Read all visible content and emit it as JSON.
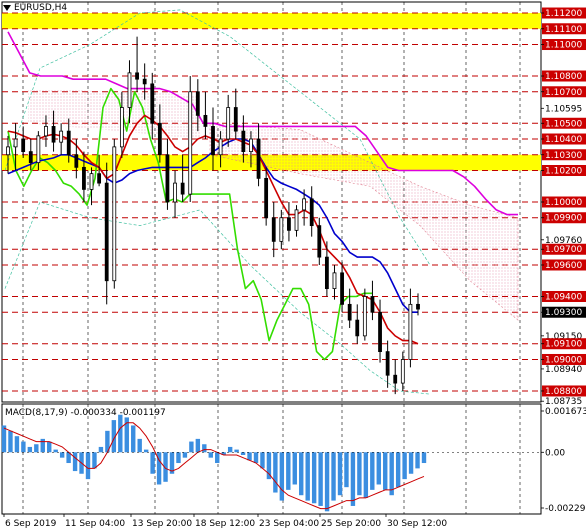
{
  "symbol": "EURUSD,H4",
  "macd_label": "MACD(8,17,9)",
  "macd_values": "-0.000334 -0.001197",
  "colors": {
    "red_level": "#c00000",
    "resist_zone": "#ffff00",
    "price_tag_red": "#cc0000",
    "price_tag_black": "#000000",
    "blue_ma": "#0000cc",
    "red_ma": "#cc0000",
    "green_line": "#33dd00",
    "magenta_line": "#dd00dd",
    "candles": "#000000",
    "macd_hist": "#3b8ee0",
    "macd_signal": "#cc0000"
  },
  "chart_data": {
    "type": "candlestick",
    "symbol": "EURUSD",
    "timeframe": "H4",
    "ylim": [
      1.0873,
      1.1127
    ],
    "y_ticks": [
      1.111,
      1.10595,
      1.10385,
      1.10175,
      1.09965,
      1.0976,
      1.0955,
      1.0934,
      1.0915,
      1.0894,
      1.08735
    ],
    "red_levels": [
      1.112,
      1.111,
      1.11,
      1.108,
      1.107,
      1.105,
      1.104,
      1.103,
      1.102,
      1.1,
      1.099,
      1.097,
      1.096,
      1.094,
      1.093,
      1.091,
      1.09,
      1.088
    ],
    "price_labels": [
      {
        "text": "1.11200",
        "style": "red"
      },
      {
        "text": "1.11100",
        "style": "red"
      },
      {
        "text": "1.11000",
        "style": "red"
      },
      {
        "text": "1.10800",
        "style": "red"
      },
      {
        "text": "1.10700",
        "style": "red"
      },
      {
        "text": "1.10595",
        "style": "plain"
      },
      {
        "text": "1.10500",
        "style": "red"
      },
      {
        "text": "1.10400",
        "style": "red"
      },
      {
        "text": "1.10300",
        "style": "red"
      },
      {
        "text": "1.10200",
        "style": "red"
      },
      {
        "text": "1.10000",
        "style": "red"
      },
      {
        "text": "1.09900",
        "style": "red"
      },
      {
        "text": "1.09760",
        "style": "plain"
      },
      {
        "text": "1.09700",
        "style": "red"
      },
      {
        "text": "1.09600",
        "style": "red"
      },
      {
        "text": "1.09400",
        "style": "red"
      },
      {
        "text": "1.09300",
        "style": "black"
      },
      {
        "text": "1.09150",
        "style": "plain"
      },
      {
        "text": "1.09100",
        "style": "red"
      },
      {
        "text": "1.09000",
        "style": "red"
      },
      {
        "text": "1.08940",
        "style": "plain"
      },
      {
        "text": "1.08800",
        "style": "red"
      },
      {
        "text": "1.08735",
        "style": "plain"
      }
    ],
    "price_label_values": [
      1.112,
      1.111,
      1.11,
      1.108,
      1.107,
      1.10595,
      1.105,
      1.104,
      1.103,
      1.102,
      1.1,
      1.099,
      1.0976,
      1.097,
      1.096,
      1.094,
      1.093,
      1.0915,
      1.091,
      1.09,
      1.0894,
      1.088,
      1.08735
    ],
    "zones": [
      [
        1.111,
        1.112
      ],
      [
        1.102,
        1.103
      ]
    ],
    "x_labels": [
      "6 Sep 2019",
      "11 Sep 04:00",
      "13 Sep 20:00",
      "18 Sep 12:00",
      "23 Sep 04:00",
      "25 Sep 20:00",
      "30 Sep 12:00"
    ],
    "candles": [
      {
        "o": 1.103,
        "h": 1.1042,
        "l": 1.1018,
        "c": 1.1035
      },
      {
        "o": 1.1035,
        "h": 1.105,
        "l": 1.102,
        "c": 1.104
      },
      {
        "o": 1.104,
        "h": 1.1048,
        "l": 1.1028,
        "c": 1.1032
      },
      {
        "o": 1.1032,
        "h": 1.104,
        "l": 1.102,
        "c": 1.1025
      },
      {
        "o": 1.1025,
        "h": 1.1045,
        "l": 1.102,
        "c": 1.1042
      },
      {
        "o": 1.1042,
        "h": 1.1055,
        "l": 1.1035,
        "c": 1.1048
      },
      {
        "o": 1.1048,
        "h": 1.1058,
        "l": 1.1032,
        "c": 1.1038
      },
      {
        "o": 1.1038,
        "h": 1.105,
        "l": 1.103,
        "c": 1.1045
      },
      {
        "o": 1.1045,
        "h": 1.1053,
        "l": 1.1025,
        "c": 1.103
      },
      {
        "o": 1.103,
        "h": 1.104,
        "l": 1.1015,
        "c": 1.1022
      },
      {
        "o": 1.1022,
        "h": 1.1032,
        "l": 1.1,
        "c": 1.1008
      },
      {
        "o": 1.1008,
        "h": 1.1022,
        "l": 1.0998,
        "c": 1.1018
      },
      {
        "o": 1.1018,
        "h": 1.103,
        "l": 1.101,
        "c": 1.1012
      },
      {
        "o": 1.1012,
        "h": 1.1025,
        "l": 1.0935,
        "c": 1.095
      },
      {
        "o": 1.095,
        "h": 1.104,
        "l": 1.0945,
        "c": 1.1035
      },
      {
        "o": 1.1035,
        "h": 1.107,
        "l": 1.1028,
        "c": 1.106
      },
      {
        "o": 1.106,
        "h": 1.109,
        "l": 1.105,
        "c": 1.1082
      },
      {
        "o": 1.1082,
        "h": 1.1105,
        "l": 1.107,
        "c": 1.1078
      },
      {
        "o": 1.1078,
        "h": 1.1088,
        "l": 1.1065,
        "c": 1.1075
      },
      {
        "o": 1.1075,
        "h": 1.1082,
        "l": 1.104,
        "c": 1.105
      },
      {
        "o": 1.105,
        "h": 1.1062,
        "l": 1.1025,
        "c": 1.103
      },
      {
        "o": 1.103,
        "h": 1.104,
        "l": 1.0995,
        "c": 1.1
      },
      {
        "o": 1.1,
        "h": 1.102,
        "l": 1.099,
        "c": 1.1012
      },
      {
        "o": 1.1012,
        "h": 1.103,
        "l": 1.1,
        "c": 1.1005
      },
      {
        "o": 1.1005,
        "h": 1.108,
        "l": 1.1,
        "c": 1.107
      },
      {
        "o": 1.107,
        "h": 1.1078,
        "l": 1.1045,
        "c": 1.1055
      },
      {
        "o": 1.1055,
        "h": 1.107,
        "l": 1.104,
        "c": 1.1048
      },
      {
        "o": 1.1048,
        "h": 1.106,
        "l": 1.102,
        "c": 1.103
      },
      {
        "o": 1.103,
        "h": 1.1045,
        "l": 1.1022,
        "c": 1.104
      },
      {
        "o": 1.104,
        "h": 1.1068,
        "l": 1.1035,
        "c": 1.106
      },
      {
        "o": 1.106,
        "h": 1.1072,
        "l": 1.104,
        "c": 1.1045
      },
      {
        "o": 1.1045,
        "h": 1.1055,
        "l": 1.1025,
        "c": 1.1032
      },
      {
        "o": 1.1032,
        "h": 1.1045,
        "l": 1.1022,
        "c": 1.104
      },
      {
        "o": 1.104,
        "h": 1.105,
        "l": 1.101,
        "c": 1.1015
      },
      {
        "o": 1.1015,
        "h": 1.1022,
        "l": 1.0985,
        "c": 1.099
      },
      {
        "o": 1.099,
        "h": 1.1,
        "l": 1.0965,
        "c": 1.0975
      },
      {
        "o": 1.0975,
        "h": 1.0995,
        "l": 1.097,
        "c": 1.099
      },
      {
        "o": 1.099,
        "h": 1.1,
        "l": 1.0975,
        "c": 1.0982
      },
      {
        "o": 1.0982,
        "h": 1.0998,
        "l": 1.0978,
        "c": 1.0995
      },
      {
        "o": 1.0995,
        "h": 1.1008,
        "l": 1.0985,
        "c": 1.1002
      },
      {
        "o": 1.1002,
        "h": 1.101,
        "l": 1.0978,
        "c": 1.0985
      },
      {
        "o": 1.0985,
        "h": 1.099,
        "l": 1.096,
        "c": 1.0965
      },
      {
        "o": 1.0965,
        "h": 1.0975,
        "l": 1.094,
        "c": 1.0945
      },
      {
        "o": 1.0945,
        "h": 1.096,
        "l": 1.0938,
        "c": 1.0955
      },
      {
        "o": 1.0955,
        "h": 1.0962,
        "l": 1.093,
        "c": 1.0935
      },
      {
        "o": 1.0935,
        "h": 1.0945,
        "l": 1.092,
        "c": 1.0925
      },
      {
        "o": 1.0925,
        "h": 1.0935,
        "l": 1.091,
        "c": 1.0915
      },
      {
        "o": 1.0915,
        "h": 1.0945,
        "l": 1.0912,
        "c": 1.094
      },
      {
        "o": 1.094,
        "h": 1.095,
        "l": 1.0925,
        "c": 1.093
      },
      {
        "o": 1.093,
        "h": 1.0938,
        "l": 1.0898,
        "c": 1.0905
      },
      {
        "o": 1.0905,
        "h": 1.0912,
        "l": 1.0882,
        "c": 1.089
      },
      {
        "o": 1.089,
        "h": 1.09,
        "l": 1.0878,
        "c": 1.0885
      },
      {
        "o": 1.0885,
        "h": 1.0905,
        "l": 1.088,
        "c": 1.09
      },
      {
        "o": 1.09,
        "h": 1.0945,
        "l": 1.0895,
        "c": 1.0935
      },
      {
        "o": 1.0935,
        "h": 1.0942,
        "l": 1.0928,
        "c": 1.0932
      }
    ],
    "blue_ma": [
      1.1018,
      1.102,
      1.1022,
      1.1024,
      1.1026,
      1.1027,
      1.1028,
      1.103,
      1.103,
      1.1028,
      1.1026,
      1.1024,
      1.1022,
      1.1015,
      1.1012,
      1.1014,
      1.1018,
      1.102,
      1.1021,
      1.1022,
      1.1022,
      1.1022,
      1.1022,
      1.1022,
      1.1022,
      1.1025,
      1.1028,
      1.1032,
      1.1035,
      1.1038,
      1.104,
      1.104,
      1.1038,
      1.103,
      1.1022,
      1.1015,
      1.1012,
      1.101,
      1.1008,
      1.1005,
      1.1002,
      1.0998,
      1.099,
      1.098,
      1.0975,
      1.0968,
      1.0965,
      1.0965,
      1.0965,
      1.0962,
      1.0955,
      1.0945,
      1.0935,
      1.093,
      1.093
    ],
    "red_ma": [
      1.1045,
      1.1044,
      1.1042,
      1.104,
      1.104,
      1.1042,
      1.1043,
      1.1042,
      1.104,
      1.1036,
      1.103,
      1.1025,
      1.1022,
      1.1015,
      1.1018,
      1.103,
      1.1042,
      1.105,
      1.1055,
      1.1052,
      1.1048,
      1.1042,
      1.1035,
      1.1032,
      1.1035,
      1.104,
      1.1042,
      1.104,
      1.1038,
      1.104,
      1.104,
      1.1038,
      1.1036,
      1.103,
      1.102,
      1.101,
      1.1,
      1.0992,
      1.0992,
      1.0995,
      1.0992,
      1.0982,
      1.097,
      1.0965,
      1.096,
      1.0952,
      1.0942,
      1.094,
      1.0938,
      1.093,
      1.092,
      1.0915,
      1.0912,
      1.0912,
      1.091
    ],
    "green_line": [
      1.1045,
      1.102,
      1.101,
      1.102,
      1.1028,
      1.1025,
      1.102,
      1.1012,
      1.101,
      1.1005,
      1.0998,
      1.1015,
      1.106,
      1.1072,
      1.1065,
      1.1045,
      1.107,
      1.106,
      1.104,
      1.1025,
      1.1,
      1.1002,
      1.1,
      1.1005,
      1.1005,
      1.1005,
      1.1005,
      1.1005,
      1.1005,
      1.097,
      1.0945,
      1.095,
      1.0938,
      1.0912,
      1.0925,
      1.0935,
      1.0945,
      1.0945,
      1.0935,
      1.0905,
      1.09,
      1.0905,
      1.0935,
      1.094,
      1.094,
      1.0942,
      1.0942
    ],
    "magenta_line": [
      1.1108,
      1.1095,
      1.1082,
      1.108,
      1.108,
      1.108,
      1.1078,
      1.1078,
      1.1078,
      1.1078,
      1.1075,
      1.1072,
      1.1072,
      1.1072,
      1.1072,
      1.107,
      1.1066,
      1.1062,
      1.105,
      1.105,
      1.1048,
      1.1048,
      1.1048,
      1.1048,
      1.1048,
      1.1048,
      1.1048,
      1.1048,
      1.1048,
      1.1048,
      1.1048,
      1.1048,
      1.1048,
      1.1042,
      1.1032,
      1.1022,
      1.102,
      1.102,
      1.102,
      1.102,
      1.102,
      1.102,
      1.1016,
      1.101,
      1.1002,
      1.0995,
      1.0992,
      1.0992
    ],
    "macd": {
      "ylim": [
        -0.0023,
        0.0018
      ],
      "ticks": [
        0.001673,
        0.0,
        -0.002297
      ],
      "tick_labels": [
        "0.001673",
        "0.00",
        "-0.002297"
      ],
      "histogram": [
        0.001,
        0.0008,
        0.0006,
        0.0004,
        0.0002,
        0.0003,
        0.0005,
        0.0004,
        0.0001,
        -0.0002,
        -0.0004,
        -0.0007,
        -0.0008,
        -0.001,
        -0.0006,
        0.0002,
        0.0008,
        0.0012,
        0.0014,
        0.0013,
        0.001,
        0.0005,
        0.0001,
        -0.0008,
        -0.0012,
        -0.0011,
        -0.0008,
        -0.0004,
        -0.0002,
        0.0004,
        0.0005,
        0.0003,
        -0.0002,
        -0.0004,
        -0.0001,
        0.0002,
        0.0001,
        -0.0001,
        -0.0003,
        -0.0004,
        -0.0006,
        -0.001,
        -0.0015,
        -0.0018,
        -0.0014,
        -0.0012,
        -0.0016,
        -0.0018,
        -0.0019,
        -0.002,
        -0.0022,
        -0.0018,
        -0.0016,
        -0.0013,
        -0.002,
        -0.0016,
        -0.0017,
        -0.0014,
        -0.0012,
        -0.0014,
        -0.0016,
        -0.0013,
        -0.001,
        -0.0008,
        -0.0006,
        -0.0004
      ],
      "signal": [
        0.0009,
        0.0008,
        0.0007,
        0.0006,
        0.0005,
        0.0004,
        0.0004,
        0.0004,
        0.0003,
        0.0002,
        0.0,
        -0.0002,
        -0.0004,
        -0.0006,
        -0.0006,
        -0.0004,
        0.0,
        0.0005,
        0.0009,
        0.0011,
        0.0011,
        0.0009,
        0.0006,
        0.0002,
        -0.0003,
        -0.0006,
        -0.0007,
        -0.0006,
        -0.0004,
        -0.0002,
        0.0,
        0.0001,
        0.0001,
        0.0,
        -0.0001,
        -0.0001,
        -0.0001,
        -0.0002,
        -0.0003,
        -0.0004,
        -0.0006,
        -0.0008,
        -0.0011,
        -0.0014,
        -0.0016,
        -0.0017,
        -0.0018,
        -0.0019,
        -0.002,
        -0.0021,
        -0.0021,
        -0.002,
        -0.0019,
        -0.0018,
        -0.0018,
        -0.0017,
        -0.0017,
        -0.0016,
        -0.0015,
        -0.0014,
        -0.0014,
        -0.0013,
        -0.0012,
        -0.0011,
        -0.001,
        -0.0009
      ]
    }
  }
}
